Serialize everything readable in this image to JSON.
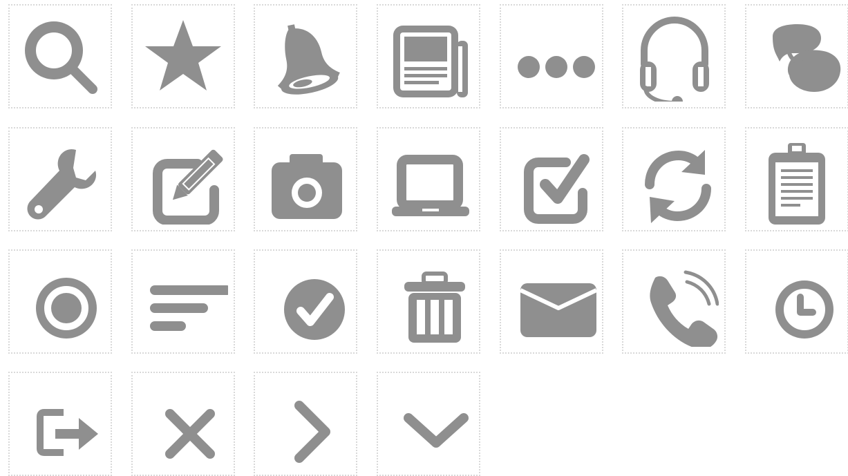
{
  "icon_color": "#8f8f8f",
  "cell_border_color": "#d8d8d8",
  "background": "#ffffff",
  "icons": [
    "search-icon",
    "star-icon",
    "bell-icon",
    "newspaper-icon",
    "more-icon",
    "headset-icon",
    "chat-icon",
    "wrench-icon",
    "edit-icon",
    "camera-icon",
    "laptop-icon",
    "checkbox-icon",
    "refresh-icon",
    "clipboard-icon",
    "record-icon",
    "align-left-icon",
    "check-circle-icon",
    "trash-icon",
    "mail-icon",
    "phone-icon",
    "clock-icon",
    "logout-icon",
    "close-icon",
    "chevron-right-icon",
    "chevron-down-icon"
  ]
}
